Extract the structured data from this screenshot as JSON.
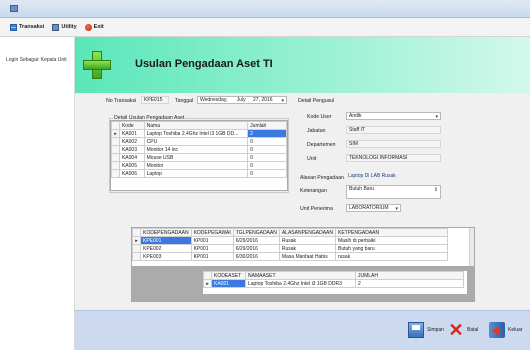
{
  "menu": {
    "transaksi": "Transaksi",
    "utility": "Utility",
    "exit": "Exit"
  },
  "sidebar": {
    "login": "Login Sebagai: Kepala Unit"
  },
  "header": {
    "title": "Usulan Pengadaan Aset TI"
  },
  "form": {
    "no_label": "No Transaksi",
    "no_value": "KPE015",
    "tanggal_label": "Tanggal",
    "tanggal_day": "Wednesday,",
    "tanggal_month": "July",
    "tanggal_date": "27, 2016",
    "detail_label": "Detail Usulan Pengadaan Aset",
    "pengusul_label": "Detail Pengusul",
    "kode_user_label": "Kode User",
    "kode_user_value": "Andik",
    "jabatan_label": "Jabatan",
    "jabatan_value": "Staff IT",
    "departemen_label": "Departemen",
    "departemen_value": "SIM",
    "unit_label": "Unit",
    "unit_value": "TEKNOLOGI INFORMASI",
    "alasan_label": "Alasan Pengadaan",
    "alasan_value": "Laptop Di LAB Rusak",
    "keterangan_label": "Keterangan",
    "keterangan_value": "Butuh Baru",
    "unit_penerima_label": "Unit Penerima",
    "unit_penerima_value": "LABORATORIUM"
  },
  "detail_table": {
    "headers": [
      "Kode",
      "Nama",
      "Jumlah"
    ],
    "rows": [
      [
        "KA001",
        "Laptop Toshiba 2.4Ghz Intel i3 1GB DD...",
        "2"
      ],
      [
        "KA002",
        "CPU",
        "0"
      ],
      [
        "KA003",
        "Monitor 14 inc",
        "0"
      ],
      [
        "KA004",
        "Mouse USB",
        "0"
      ],
      [
        "KA005",
        "Monitor",
        "0"
      ],
      [
        "KA006",
        "Laptop",
        "0"
      ]
    ]
  },
  "pengadaan_table": {
    "headers": [
      "KODEPENGADAAN",
      "KODEPEGAWAI",
      "TGLPENGADAAN",
      "ALASANPENGADAAN",
      "KETPENGADAAN"
    ],
    "rows": [
      [
        "KPE001",
        "KP001",
        "6/29/2016",
        "Rusak",
        "Masih di perbaiki"
      ],
      [
        "KPE002",
        "KP001",
        "6/29/2016",
        "Rusak",
        "Butuh yang baru"
      ],
      [
        "KPE003",
        "KP001",
        "6/30/2016",
        "Masa Manfaat Habis",
        "rusak"
      ]
    ]
  },
  "aset_table": {
    "headers": [
      "KODEASET",
      "NAMAASET",
      "JUMLAH"
    ],
    "rows": [
      [
        "KA001",
        "Laptop Toshiba 2.4Ghz Intel i3 1GB DDR3",
        "2"
      ]
    ]
  },
  "buttons": {
    "simpan": "Simpan",
    "batal": "Batal",
    "keluar": "Keluar"
  },
  "colors": {
    "header_accent": "#5ae6b9",
    "selection": "#3a7ae0",
    "footer": "#cdd9ee"
  }
}
